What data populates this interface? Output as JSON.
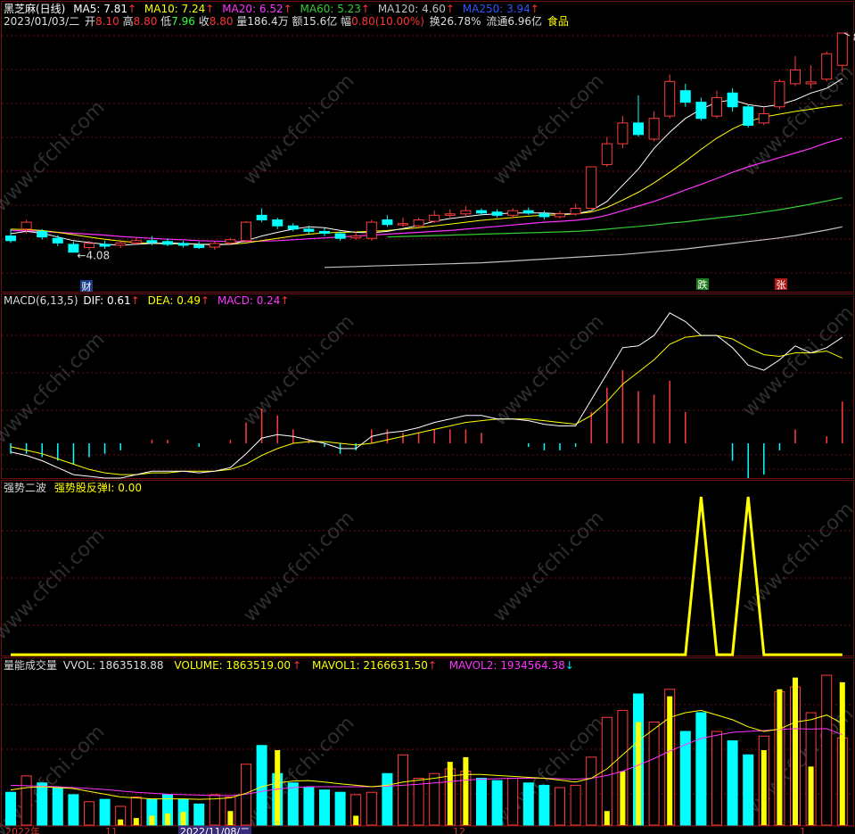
{
  "colors": {
    "background": "#000000",
    "grid": "#6b1010",
    "up": "#ff3c3c",
    "down": "#00ffff",
    "ma5": "#ffffff",
    "ma10": "#ffff00",
    "ma20": "#ff33ff",
    "ma60": "#33cc33",
    "ma120": "#c0c0c0",
    "ma250": "#3355ff",
    "signal": "#ffff00"
  },
  "header": {
    "title": "黑芝麻(日线)",
    "ma5": "MA5: 7.81",
    "ma10": "MA10: 7.24",
    "ma20": "MA20: 6.52",
    "ma60": "MA60: 5.23",
    "ma120": "MA120: 4.60",
    "ma250": "MA250: 3.94",
    "arrow": "↑",
    "date": "2023/01/03/二",
    "open_label": "开",
    "open": "8.10",
    "high_label": "高",
    "high": "8.80",
    "low_label": "低",
    "low": "7.96",
    "close_label": "收",
    "close": "8.80",
    "vol": "量186.4万",
    "amount": "额15.6亿",
    "change_label": "幅",
    "change": "0.80(10.00%)",
    "turnover": "换26.78%",
    "float": "流通6.96亿",
    "sector": "食品"
  },
  "macd_header": {
    "name": "MACD(6,13,5)",
    "dif": "DIF: 0.61",
    "dea": "DEA: 0.49",
    "macd": "MACD: 0.24",
    "arrow": "↑"
  },
  "signal_header": {
    "name": "强势二波",
    "value": "强势股反弹I: 0.00"
  },
  "volume_header": {
    "name": "量能成交量",
    "vvol": "VVOL: 1863518.88",
    "volume": "VOLUME: 1863519.00",
    "mavol1": "MAVOL1: 2166631.50",
    "mavol2": "MAVOL2: 1934564.38",
    "up_arrow": "↑",
    "down_arrow": "↓"
  },
  "annotations": {
    "high_price": "8.80",
    "low_price": "4.08",
    "badge_cai": "财",
    "badge_die": "跌",
    "badge_zhang": "张"
  },
  "xaxis_labels": [
    "2022年",
    "11",
    "2022/11/08/二",
    "12",
    "1"
  ],
  "watermark": "www.cfchi.com",
  "chart_data": {
    "type": "candlestick",
    "candles": [
      [
        4.4,
        4.3,
        4.55,
        4.25
      ],
      [
        4.55,
        4.7,
        4.75,
        4.45
      ],
      [
        4.5,
        4.38,
        4.55,
        4.32
      ],
      [
        4.35,
        4.25,
        4.42,
        4.18
      ],
      [
        4.22,
        4.05,
        4.28,
        4.08
      ],
      [
        4.15,
        4.24,
        4.3,
        4.1
      ],
      [
        4.22,
        4.18,
        4.3,
        4.12
      ],
      [
        4.2,
        4.25,
        4.32,
        4.14
      ],
      [
        4.25,
        4.3,
        4.38,
        4.2
      ],
      [
        4.3,
        4.26,
        4.4,
        4.2
      ],
      [
        4.28,
        4.22,
        4.35,
        4.18
      ],
      [
        4.24,
        4.2,
        4.3,
        4.15
      ],
      [
        4.2,
        4.15,
        4.28,
        4.12
      ],
      [
        4.16,
        4.24,
        4.28,
        4.1
      ],
      [
        4.25,
        4.32,
        4.36,
        4.2
      ],
      [
        4.3,
        4.7,
        4.72,
        4.28
      ],
      [
        4.85,
        4.75,
        5.0,
        4.7
      ],
      [
        4.75,
        4.62,
        4.8,
        4.55
      ],
      [
        4.62,
        4.55,
        4.68,
        4.5
      ],
      [
        4.55,
        4.5,
        4.62,
        4.45
      ],
      [
        4.5,
        4.46,
        4.58,
        4.4
      ],
      [
        4.45,
        4.35,
        4.5,
        4.3
      ],
      [
        4.36,
        4.4,
        4.5,
        4.32
      ],
      [
        4.35,
        4.7,
        4.75,
        4.3
      ],
      [
        4.75,
        4.65,
        4.85,
        4.6
      ],
      [
        4.65,
        4.67,
        4.8,
        4.6
      ],
      [
        4.62,
        4.75,
        4.8,
        4.58
      ],
      [
        4.72,
        4.85,
        4.95,
        4.68
      ],
      [
        4.85,
        4.88,
        4.98,
        4.8
      ],
      [
        4.88,
        4.95,
        5.05,
        4.82
      ],
      [
        4.95,
        4.9,
        5.0,
        4.85
      ],
      [
        4.92,
        4.85,
        4.98,
        4.8
      ],
      [
        4.85,
        4.95,
        5.0,
        4.8
      ],
      [
        4.95,
        4.9,
        5.02,
        4.86
      ],
      [
        4.88,
        4.82,
        4.95,
        4.76
      ],
      [
        4.82,
        4.88,
        4.95,
        4.78
      ],
      [
        4.88,
        5.0,
        5.1,
        4.84
      ],
      [
        5.0,
        5.9,
        5.9,
        4.98
      ],
      [
        5.95,
        6.4,
        6.55,
        5.9
      ],
      [
        6.4,
        6.85,
        7.0,
        6.3
      ],
      [
        6.85,
        6.6,
        7.45,
        6.55
      ],
      [
        6.5,
        6.95,
        7.1,
        6.45
      ],
      [
        7.0,
        7.75,
        7.9,
        6.95
      ],
      [
        7.55,
        7.3,
        7.7,
        7.2
      ],
      [
        7.3,
        6.95,
        7.4,
        6.9
      ],
      [
        7.0,
        7.4,
        7.55,
        6.95
      ],
      [
        7.5,
        7.2,
        7.6,
        7.1
      ],
      [
        7.2,
        6.8,
        7.25,
        6.75
      ],
      [
        6.85,
        7.05,
        7.2,
        6.8
      ],
      [
        7.2,
        7.75,
        7.8,
        7.15
      ],
      [
        7.7,
        8.0,
        8.3,
        7.65
      ],
      [
        7.7,
        7.74,
        8.1,
        7.6
      ],
      [
        7.8,
        8.35,
        8.4,
        7.75
      ],
      [
        8.1,
        8.8,
        8.8,
        7.96
      ]
    ],
    "ma5": [
      4.45,
      4.5,
      4.46,
      4.38,
      4.3,
      4.26,
      4.22,
      4.2,
      4.22,
      4.24,
      4.25,
      4.24,
      4.22,
      4.21,
      4.22,
      4.3,
      4.4,
      4.48,
      4.55,
      4.6,
      4.58,
      4.52,
      4.48,
      4.47,
      4.5,
      4.56,
      4.63,
      4.72,
      4.78,
      4.82,
      4.86,
      4.88,
      4.9,
      4.9,
      4.9,
      4.88,
      4.88,
      4.95,
      5.15,
      5.5,
      5.85,
      6.3,
      6.65,
      6.95,
      7.15,
      7.3,
      7.35,
      7.25,
      7.2,
      7.25,
      7.35,
      7.5,
      7.6,
      7.81
    ],
    "ma10": [
      4.55,
      4.54,
      4.52,
      4.48,
      4.43,
      4.38,
      4.33,
      4.29,
      4.26,
      4.24,
      4.23,
      4.23,
      4.22,
      4.22,
      4.22,
      4.25,
      4.3,
      4.35,
      4.4,
      4.44,
      4.47,
      4.48,
      4.49,
      4.5,
      4.52,
      4.55,
      4.58,
      4.62,
      4.66,
      4.7,
      4.74,
      4.77,
      4.8,
      4.83,
      4.85,
      4.86,
      4.88,
      4.92,
      5.02,
      5.18,
      5.35,
      5.55,
      5.78,
      6.02,
      6.28,
      6.52,
      6.72,
      6.88,
      6.98,
      7.04,
      7.1,
      7.15,
      7.2,
      7.24
    ],
    "ma20": [
      4.52,
      4.51,
      4.5,
      4.48,
      4.46,
      4.44,
      4.42,
      4.39,
      4.37,
      4.35,
      4.33,
      4.32,
      4.3,
      4.29,
      4.28,
      4.28,
      4.29,
      4.3,
      4.32,
      4.34,
      4.36,
      4.38,
      4.4,
      4.42,
      4.44,
      4.46,
      4.48,
      4.5,
      4.52,
      4.55,
      4.58,
      4.61,
      4.64,
      4.67,
      4.7,
      4.72,
      4.74,
      4.78,
      4.85,
      4.95,
      5.05,
      5.15,
      5.27,
      5.4,
      5.52,
      5.65,
      5.78,
      5.9,
      6.0,
      6.1,
      6.2,
      6.3,
      6.42,
      6.52
    ],
    "ma60": [
      null,
      null,
      null,
      null,
      null,
      null,
      null,
      null,
      null,
      null,
      null,
      null,
      null,
      null,
      null,
      null,
      null,
      null,
      null,
      null,
      null,
      null,
      null,
      null,
      4.38,
      4.39,
      4.4,
      4.41,
      4.42,
      4.43,
      4.44,
      4.45,
      4.46,
      4.47,
      4.48,
      4.49,
      4.5,
      4.52,
      4.55,
      4.58,
      4.61,
      4.64,
      4.68,
      4.71,
      4.75,
      4.79,
      4.83,
      4.87,
      4.92,
      4.97,
      5.03,
      5.09,
      5.16,
      5.23
    ],
    "ma120": [
      null,
      null,
      null,
      null,
      null,
      null,
      null,
      null,
      null,
      null,
      null,
      null,
      null,
      null,
      null,
      null,
      null,
      null,
      null,
      null,
      3.72,
      3.73,
      3.74,
      3.75,
      3.76,
      3.77,
      3.78,
      3.79,
      3.8,
      3.81,
      3.82,
      3.84,
      3.86,
      3.88,
      3.9,
      3.92,
      3.94,
      3.96,
      3.98,
      4.0,
      4.03,
      4.06,
      4.09,
      4.12,
      4.16,
      4.2,
      4.24,
      4.28,
      4.32,
      4.36,
      4.41,
      4.47,
      4.53,
      4.6
    ],
    "dif": [
      -0.05,
      -0.07,
      -0.1,
      -0.14,
      -0.18,
      -0.19,
      -0.2,
      -0.2,
      -0.18,
      -0.16,
      -0.16,
      -0.16,
      -0.17,
      -0.16,
      -0.14,
      -0.06,
      0.03,
      0.05,
      0.04,
      0.02,
      0.0,
      -0.03,
      -0.03,
      0.04,
      0.06,
      0.07,
      0.09,
      0.12,
      0.14,
      0.16,
      0.16,
      0.14,
      0.14,
      0.13,
      0.11,
      0.1,
      0.1,
      0.25,
      0.4,
      0.55,
      0.56,
      0.62,
      0.75,
      0.7,
      0.62,
      0.62,
      0.55,
      0.45,
      0.42,
      0.48,
      0.56,
      0.52,
      0.55,
      0.61
    ],
    "dea": [
      -0.02,
      -0.04,
      -0.06,
      -0.09,
      -0.12,
      -0.15,
      -0.17,
      -0.18,
      -0.18,
      -0.17,
      -0.17,
      -0.16,
      -0.16,
      -0.16,
      -0.15,
      -0.12,
      -0.07,
      -0.03,
      0.0,
      0.01,
      0.01,
      0.0,
      -0.01,
      0.0,
      0.02,
      0.04,
      0.06,
      0.08,
      0.1,
      0.12,
      0.13,
      0.14,
      0.14,
      0.14,
      0.13,
      0.12,
      0.11,
      0.16,
      0.24,
      0.34,
      0.41,
      0.48,
      0.57,
      0.61,
      0.62,
      0.62,
      0.6,
      0.55,
      0.51,
      0.5,
      0.52,
      0.52,
      0.53,
      0.49
    ],
    "signal": [
      0,
      0,
      0,
      0,
      0,
      0,
      0,
      0,
      0,
      0,
      0,
      0,
      0,
      0,
      0,
      0,
      0,
      0,
      0,
      0,
      0,
      0,
      0,
      0,
      0,
      0,
      0,
      0,
      0,
      0,
      0,
      0,
      0,
      0,
      0,
      0,
      0,
      0,
      0,
      0,
      0,
      0,
      0,
      0,
      1,
      0,
      0,
      1,
      0,
      0,
      0,
      0,
      0,
      0
    ],
    "volume": [
      0.7,
      1.05,
      0.9,
      0.8,
      0.65,
      0.5,
      0.55,
      0.4,
      0.6,
      0.55,
      0.65,
      0.55,
      0.45,
      0.65,
      0.6,
      1.3,
      1.7,
      1.1,
      0.9,
      0.8,
      0.75,
      0.7,
      0.65,
      0.7,
      1.1,
      1.5,
      1.0,
      1.1,
      1.2,
      1.15,
      1.0,
      0.95,
      1.0,
      0.9,
      0.85,
      0.8,
      0.85,
      1.45,
      2.3,
      2.45,
      2.8,
      2.2,
      2.9,
      2.0,
      2.4,
      2.0,
      1.8,
      1.5,
      1.9,
      2.85,
      2.95,
      2.4,
      3.2,
      1.86
    ],
    "mavol1": [
      0.75,
      0.8,
      0.82,
      0.8,
      0.78,
      0.72,
      0.66,
      0.6,
      0.58,
      0.56,
      0.56,
      0.56,
      0.55,
      0.56,
      0.58,
      0.68,
      0.82,
      0.9,
      0.94,
      0.95,
      0.92,
      0.88,
      0.85,
      0.82,
      0.85,
      0.92,
      0.96,
      1.0,
      1.05,
      1.08,
      1.08,
      1.06,
      1.04,
      1.02,
      1.0,
      0.96,
      0.92,
      1.0,
      1.2,
      1.5,
      1.8,
      2.05,
      2.3,
      2.4,
      2.45,
      2.35,
      2.25,
      2.1,
      2.0,
      2.05,
      2.2,
      2.25,
      2.35,
      2.17
    ],
    "mavol2": [
      0.85,
      0.84,
      0.83,
      0.82,
      0.8,
      0.78,
      0.76,
      0.73,
      0.7,
      0.68,
      0.66,
      0.65,
      0.64,
      0.63,
      0.63,
      0.66,
      0.72,
      0.77,
      0.8,
      0.82,
      0.82,
      0.82,
      0.82,
      0.82,
      0.83,
      0.85,
      0.87,
      0.9,
      0.93,
      0.96,
      0.98,
      0.99,
      1.0,
      1.0,
      1.0,
      0.99,
      0.98,
      1.0,
      1.06,
      1.15,
      1.28,
      1.42,
      1.58,
      1.72,
      1.85,
      1.92,
      1.98,
      2.0,
      2.02,
      2.04,
      2.06,
      2.05,
      2.06,
      1.93
    ],
    "volume_unit": "百万"
  }
}
